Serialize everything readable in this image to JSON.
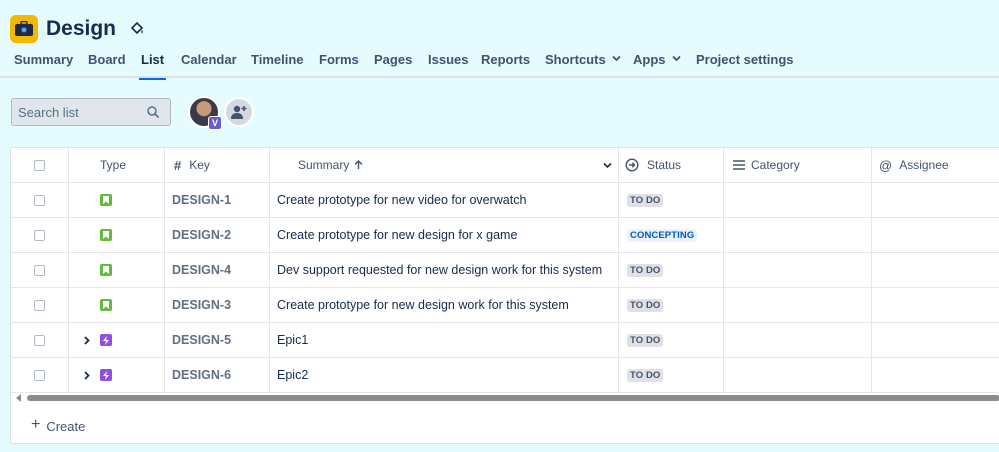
{
  "project": {
    "title": "Design"
  },
  "tabs": [
    {
      "label": "Summary"
    },
    {
      "label": "Board"
    },
    {
      "label": "List"
    },
    {
      "label": "Calendar"
    },
    {
      "label": "Timeline"
    },
    {
      "label": "Forms"
    },
    {
      "label": "Pages"
    },
    {
      "label": "Issues"
    },
    {
      "label": "Reports"
    },
    {
      "label": "Shortcuts"
    },
    {
      "label": "Apps"
    },
    {
      "label": "Project settings"
    }
  ],
  "active_tab": "List",
  "search": {
    "placeholder": "Search list"
  },
  "avatar": {
    "badge": "V"
  },
  "table": {
    "columns": {
      "type": "Type",
      "key": "Key",
      "summary": "Summary",
      "status": "Status",
      "category": "Category",
      "assignee": "Assignee"
    },
    "rows": [
      {
        "key": "DESIGN-1",
        "summary": "Create prototype for new video for overwatch",
        "status": "TO DO",
        "type": "story"
      },
      {
        "key": "DESIGN-2",
        "summary": "Create prototype for new design for x game",
        "status": "CONCEPTING",
        "type": "story"
      },
      {
        "key": "DESIGN-4",
        "summary": "Dev support requested for new design work for this system",
        "status": "TO DO",
        "type": "story"
      },
      {
        "key": "DESIGN-3",
        "summary": "Create prototype for new design work for this system",
        "status": "TO DO",
        "type": "story"
      },
      {
        "key": "DESIGN-5",
        "summary": "Epic1",
        "status": "TO DO",
        "type": "epic"
      },
      {
        "key": "DESIGN-6",
        "summary": "Epic2",
        "status": "TO DO",
        "type": "epic"
      }
    ]
  },
  "create": {
    "label": "Create"
  },
  "colors": {
    "background": "#e6fbfd",
    "accent": "#0c66e4",
    "story": "#63ba3c",
    "epic": "#904ee2",
    "project_icon": "#f5b800"
  }
}
